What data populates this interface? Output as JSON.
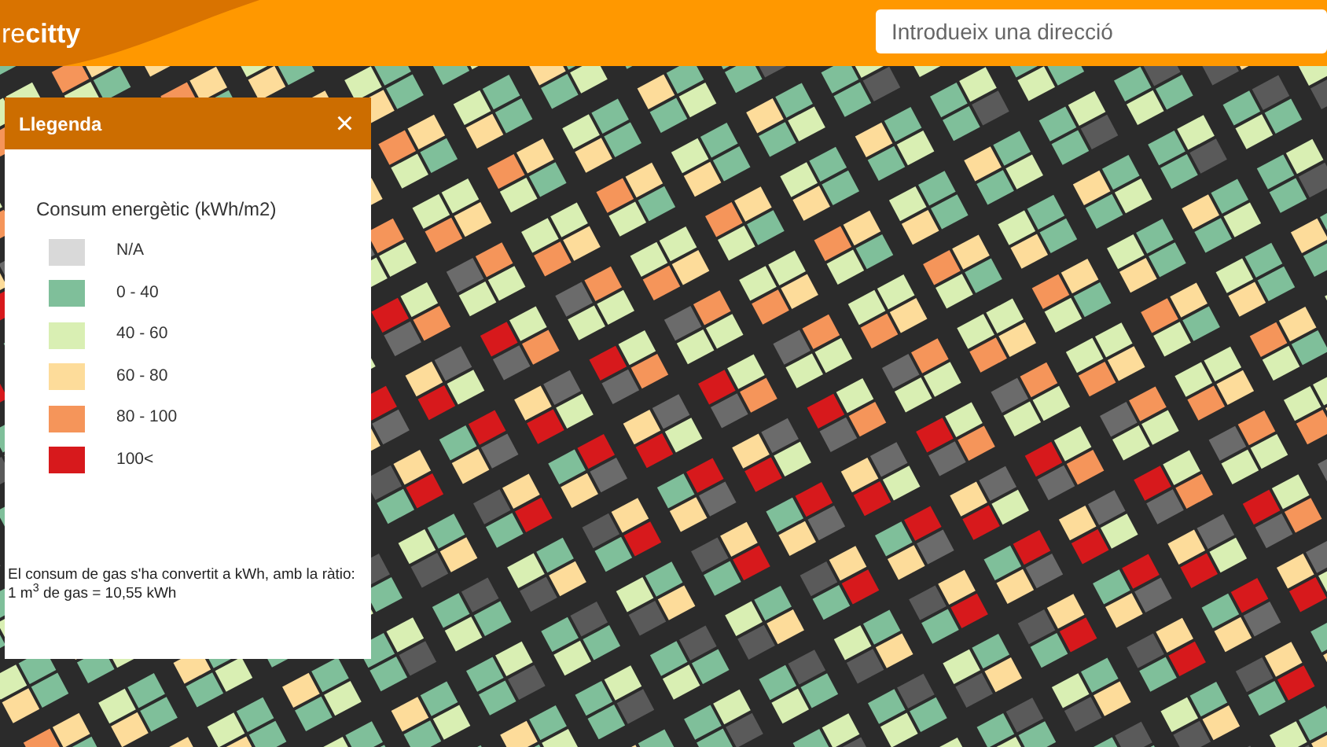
{
  "header": {
    "logo": "re**citty**",
    "search": {
      "placeholder": "Introdueix una direcció"
    }
  },
  "legend": {
    "title": "Llegenda",
    "close": "×",
    "heading": "Consum energètic (kWh/m2)",
    "items": [
      {
        "label": "N/A",
        "color": "#d9d9d9"
      },
      {
        "label": "0 - 40",
        "color": "#7fbf9a"
      },
      {
        "label": "40 - 60",
        "color": "#d9efb3"
      },
      {
        "label": "60 - 80",
        "color": "#fddc9a"
      },
      {
        "label": "80 - 100",
        "color": "#f5955a"
      },
      {
        "label": "100<",
        "color": "#d7191c"
      }
    ],
    "note": [
      "El consum de gas s'ha convertit a kWh, amb la ràtio:",
      "1 m$^{3}$ de gas = 10,55 kWh"
    ]
  }
}
